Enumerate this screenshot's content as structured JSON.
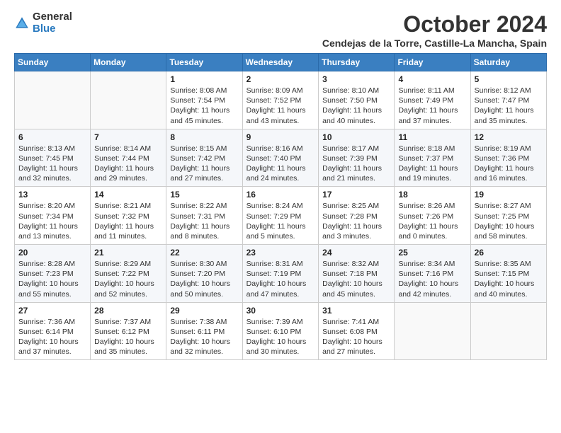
{
  "logo": {
    "general": "General",
    "blue": "Blue"
  },
  "title": "October 2024",
  "subtitle": "Cendejas de la Torre, Castille-La Mancha, Spain",
  "days_of_week": [
    "Sunday",
    "Monday",
    "Tuesday",
    "Wednesday",
    "Thursday",
    "Friday",
    "Saturday"
  ],
  "weeks": [
    [
      {
        "day": "",
        "info": ""
      },
      {
        "day": "",
        "info": ""
      },
      {
        "day": "1",
        "info": "Sunrise: 8:08 AM\nSunset: 7:54 PM\nDaylight: 11 hours and 45 minutes."
      },
      {
        "day": "2",
        "info": "Sunrise: 8:09 AM\nSunset: 7:52 PM\nDaylight: 11 hours and 43 minutes."
      },
      {
        "day": "3",
        "info": "Sunrise: 8:10 AM\nSunset: 7:50 PM\nDaylight: 11 hours and 40 minutes."
      },
      {
        "day": "4",
        "info": "Sunrise: 8:11 AM\nSunset: 7:49 PM\nDaylight: 11 hours and 37 minutes."
      },
      {
        "day": "5",
        "info": "Sunrise: 8:12 AM\nSunset: 7:47 PM\nDaylight: 11 hours and 35 minutes."
      }
    ],
    [
      {
        "day": "6",
        "info": "Sunrise: 8:13 AM\nSunset: 7:45 PM\nDaylight: 11 hours and 32 minutes."
      },
      {
        "day": "7",
        "info": "Sunrise: 8:14 AM\nSunset: 7:44 PM\nDaylight: 11 hours and 29 minutes."
      },
      {
        "day": "8",
        "info": "Sunrise: 8:15 AM\nSunset: 7:42 PM\nDaylight: 11 hours and 27 minutes."
      },
      {
        "day": "9",
        "info": "Sunrise: 8:16 AM\nSunset: 7:40 PM\nDaylight: 11 hours and 24 minutes."
      },
      {
        "day": "10",
        "info": "Sunrise: 8:17 AM\nSunset: 7:39 PM\nDaylight: 11 hours and 21 minutes."
      },
      {
        "day": "11",
        "info": "Sunrise: 8:18 AM\nSunset: 7:37 PM\nDaylight: 11 hours and 19 minutes."
      },
      {
        "day": "12",
        "info": "Sunrise: 8:19 AM\nSunset: 7:36 PM\nDaylight: 11 hours and 16 minutes."
      }
    ],
    [
      {
        "day": "13",
        "info": "Sunrise: 8:20 AM\nSunset: 7:34 PM\nDaylight: 11 hours and 13 minutes."
      },
      {
        "day": "14",
        "info": "Sunrise: 8:21 AM\nSunset: 7:32 PM\nDaylight: 11 hours and 11 minutes."
      },
      {
        "day": "15",
        "info": "Sunrise: 8:22 AM\nSunset: 7:31 PM\nDaylight: 11 hours and 8 minutes."
      },
      {
        "day": "16",
        "info": "Sunrise: 8:24 AM\nSunset: 7:29 PM\nDaylight: 11 hours and 5 minutes."
      },
      {
        "day": "17",
        "info": "Sunrise: 8:25 AM\nSunset: 7:28 PM\nDaylight: 11 hours and 3 minutes."
      },
      {
        "day": "18",
        "info": "Sunrise: 8:26 AM\nSunset: 7:26 PM\nDaylight: 11 hours and 0 minutes."
      },
      {
        "day": "19",
        "info": "Sunrise: 8:27 AM\nSunset: 7:25 PM\nDaylight: 10 hours and 58 minutes."
      }
    ],
    [
      {
        "day": "20",
        "info": "Sunrise: 8:28 AM\nSunset: 7:23 PM\nDaylight: 10 hours and 55 minutes."
      },
      {
        "day": "21",
        "info": "Sunrise: 8:29 AM\nSunset: 7:22 PM\nDaylight: 10 hours and 52 minutes."
      },
      {
        "day": "22",
        "info": "Sunrise: 8:30 AM\nSunset: 7:20 PM\nDaylight: 10 hours and 50 minutes."
      },
      {
        "day": "23",
        "info": "Sunrise: 8:31 AM\nSunset: 7:19 PM\nDaylight: 10 hours and 47 minutes."
      },
      {
        "day": "24",
        "info": "Sunrise: 8:32 AM\nSunset: 7:18 PM\nDaylight: 10 hours and 45 minutes."
      },
      {
        "day": "25",
        "info": "Sunrise: 8:34 AM\nSunset: 7:16 PM\nDaylight: 10 hours and 42 minutes."
      },
      {
        "day": "26",
        "info": "Sunrise: 8:35 AM\nSunset: 7:15 PM\nDaylight: 10 hours and 40 minutes."
      }
    ],
    [
      {
        "day": "27",
        "info": "Sunrise: 7:36 AM\nSunset: 6:14 PM\nDaylight: 10 hours and 37 minutes."
      },
      {
        "day": "28",
        "info": "Sunrise: 7:37 AM\nSunset: 6:12 PM\nDaylight: 10 hours and 35 minutes."
      },
      {
        "day": "29",
        "info": "Sunrise: 7:38 AM\nSunset: 6:11 PM\nDaylight: 10 hours and 32 minutes."
      },
      {
        "day": "30",
        "info": "Sunrise: 7:39 AM\nSunset: 6:10 PM\nDaylight: 10 hours and 30 minutes."
      },
      {
        "day": "31",
        "info": "Sunrise: 7:41 AM\nSunset: 6:08 PM\nDaylight: 10 hours and 27 minutes."
      },
      {
        "day": "",
        "info": ""
      },
      {
        "day": "",
        "info": ""
      }
    ]
  ]
}
